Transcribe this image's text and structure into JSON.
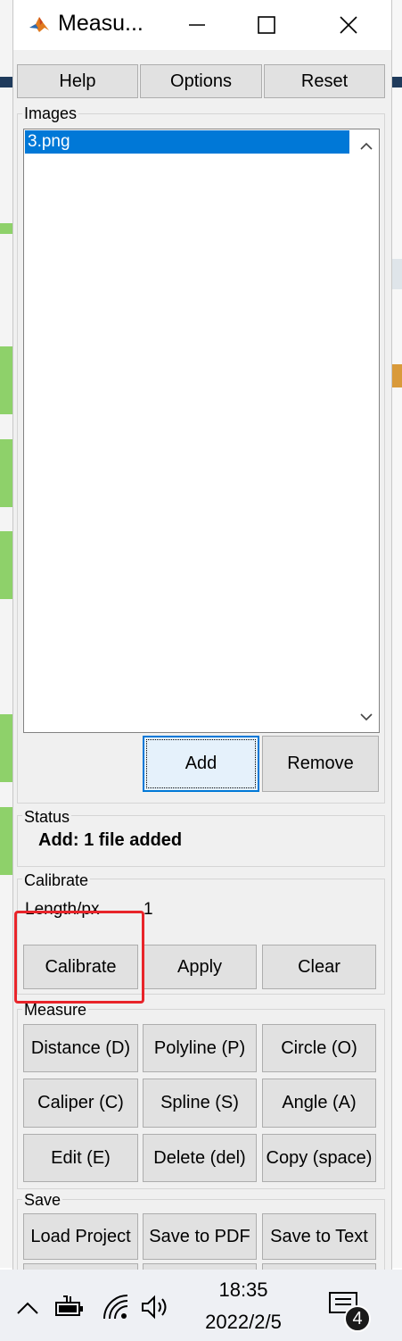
{
  "window": {
    "title": "Measu...",
    "controls": {
      "minimize": "—",
      "maximize": "☐",
      "close": "✕"
    }
  },
  "toolbar": {
    "help": "Help",
    "options": "Options",
    "reset": "Reset"
  },
  "images": {
    "title": "Images",
    "items": [
      "3.png"
    ],
    "add": "Add",
    "remove": "Remove"
  },
  "status": {
    "title": "Status",
    "message": "Add: 1 file added"
  },
  "calibrate": {
    "title": "Calibrate",
    "length_label": "Length/px",
    "length_value": "1",
    "calibrate": "Calibrate",
    "apply": "Apply",
    "clear": "Clear"
  },
  "measure": {
    "title": "Measure",
    "buttons": [
      "Distance (D)",
      "Polyline (P)",
      "Circle (O)",
      "Caliper (C)",
      "Spline (S)",
      "Angle (A)",
      "Edit (E)",
      "Delete (del)",
      "Copy (space)"
    ]
  },
  "save": {
    "title": "Save",
    "buttons": [
      "Load Project",
      "Save to PDF",
      "Save to Text"
    ]
  },
  "taskbar": {
    "time": "18:35",
    "date": "2022/2/5",
    "notification_count": "4",
    "icons": [
      "chevron-up-icon",
      "battery-icon",
      "wifi-icon",
      "volume-icon",
      "notification-icon"
    ]
  },
  "colors": {
    "selection": "#0078d7",
    "highlight_box": "#e8242a",
    "window_bg": "#f0f0f0"
  }
}
